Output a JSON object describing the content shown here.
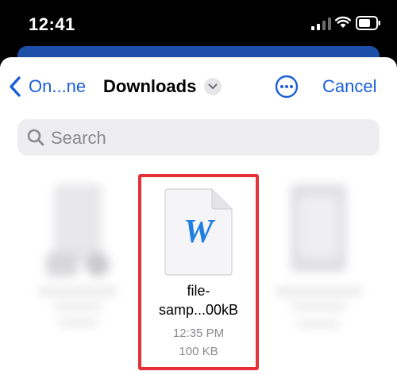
{
  "status": {
    "time": "12:41"
  },
  "nav": {
    "back_label": "On...ne",
    "title": "Downloads",
    "cancel_label": "Cancel"
  },
  "search": {
    "placeholder": "Search"
  },
  "file": {
    "name_line1": "file-",
    "name_line2": "samp...00kB",
    "time": "12:35 PM",
    "size": "100 KB",
    "icon_letter": "W"
  },
  "colors": {
    "accent": "#1a5fd6",
    "highlight": "#e53038",
    "word_blue": "#1f7fe0"
  }
}
